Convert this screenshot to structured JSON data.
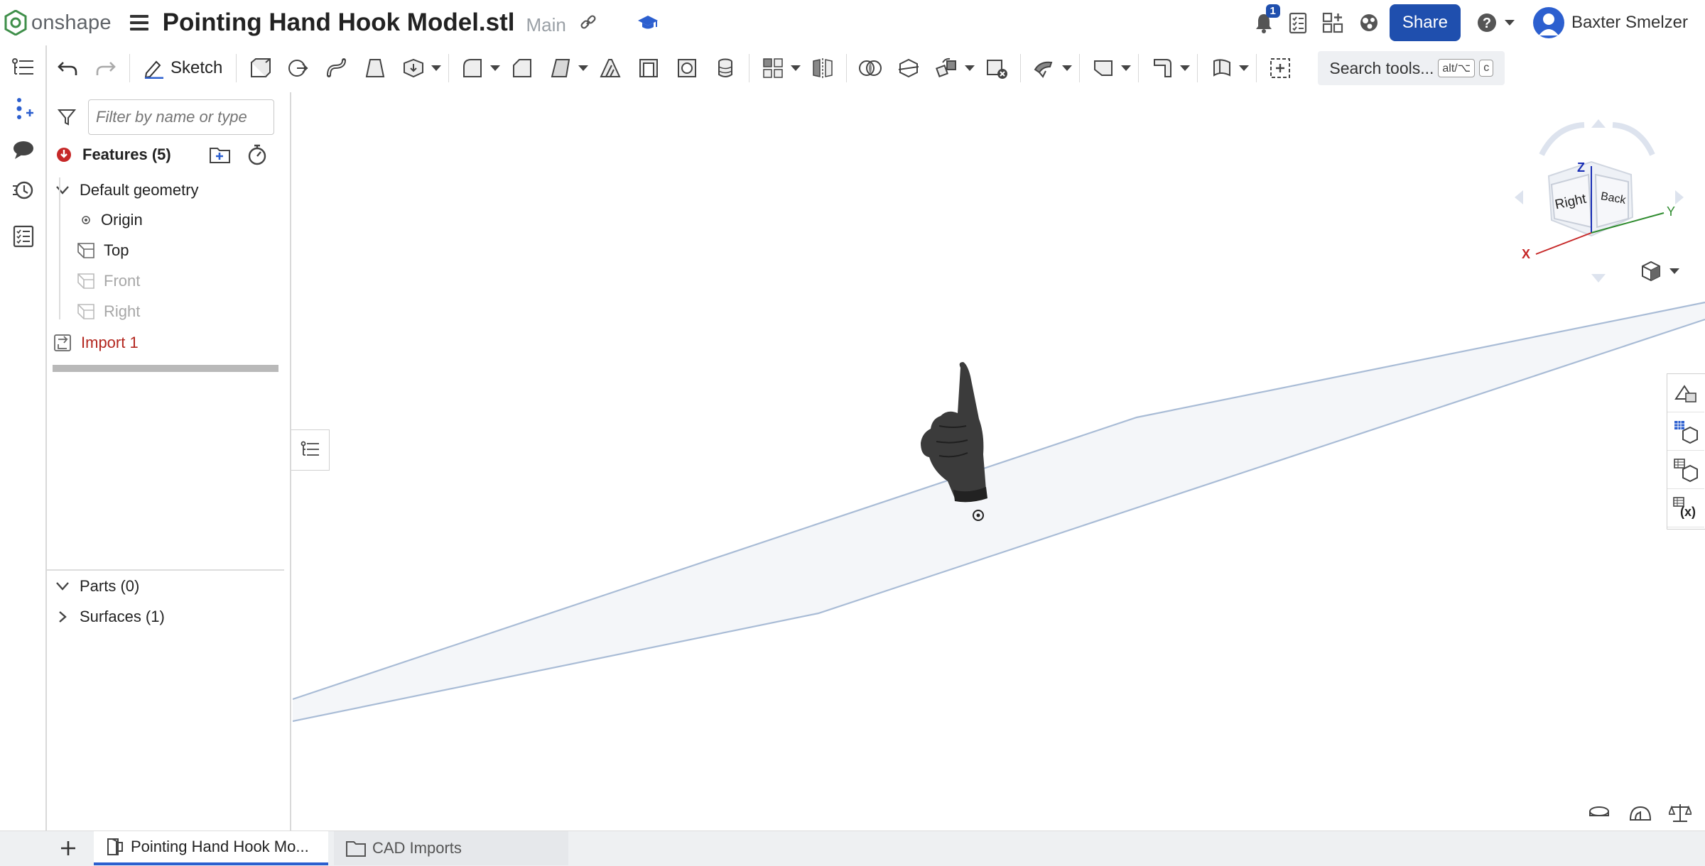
{
  "app": {
    "name": "onshape"
  },
  "document": {
    "title": "Pointing Hand Hook Model.stl",
    "branch": "Main"
  },
  "header": {
    "notifications_count": "1",
    "share_label": "Share",
    "user_name": "Baxter Smelzer",
    "icons": [
      "hamburger-icon",
      "link-icon",
      "learning-center-icon",
      "notifications-icon",
      "tasks-icon",
      "app-store-icon",
      "integrations-icon",
      "help-icon",
      "user-avatar"
    ]
  },
  "toolbar": {
    "sketch_label": "Sketch",
    "search_label": "Search tools...",
    "search_kbd1": "alt/⌥",
    "search_kbd2": "c"
  },
  "feature_panel": {
    "filter_placeholder": "Filter by name or type",
    "features_header": "Features (5)",
    "default_geometry": "Default geometry",
    "items": [
      {
        "label": "Origin",
        "state": "normal"
      },
      {
        "label": "Top",
        "state": "normal"
      },
      {
        "label": "Front",
        "state": "hidden"
      },
      {
        "label": "Right",
        "state": "hidden"
      }
    ],
    "import_item": {
      "label": "Import 1",
      "state": "error"
    },
    "parts_header": "Parts (0)",
    "surfaces_header": "Surfaces (1)"
  },
  "view_cube": {
    "face_right": "Right",
    "face_back": "Back",
    "axis_x": "X",
    "axis_y": "Y",
    "axis_z": "Z"
  },
  "bottom_tabs": [
    {
      "label": "Pointing Hand Hook Mo...",
      "active": true
    },
    {
      "label": "CAD Imports",
      "active": false
    }
  ],
  "colors": {
    "accent": "#1f4fae",
    "error": "#b3261e",
    "plane_edge": "#a9bcd6",
    "plane_fill": "#f4f6f9",
    "axis_x": "#c62828",
    "axis_y": "#2e8b2e",
    "axis_z": "#1a2fb5"
  }
}
